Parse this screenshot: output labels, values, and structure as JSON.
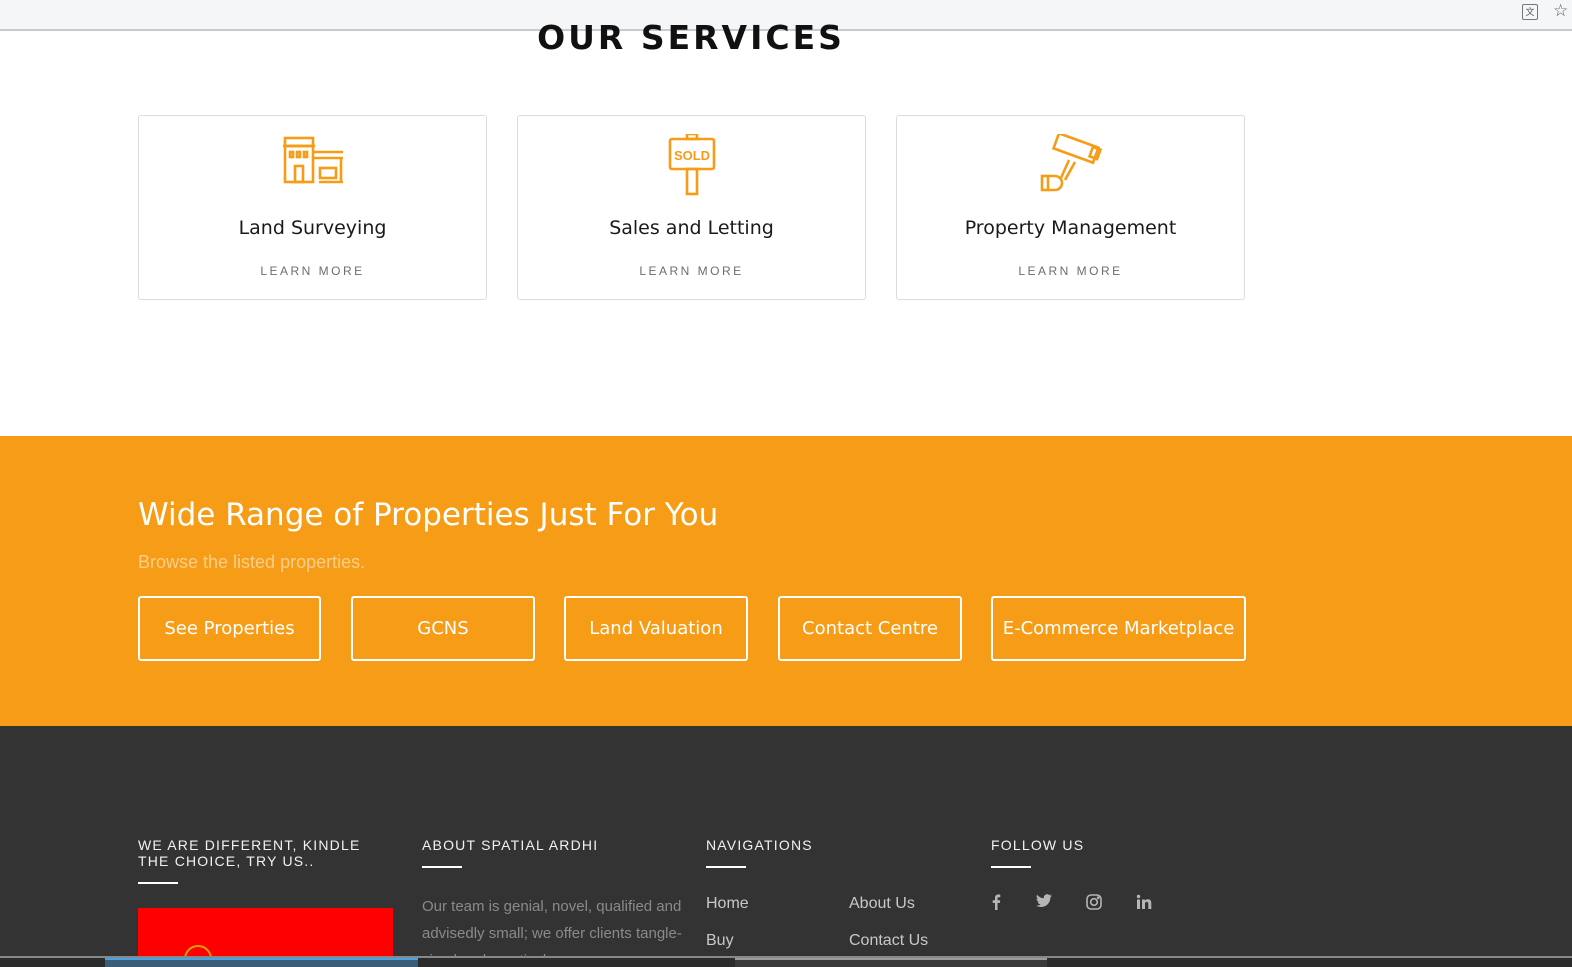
{
  "browser": {
    "translate_icon": "translate-icon",
    "bookmark_icon": "star-icon"
  },
  "services": {
    "title": "OUR SERVICES",
    "accent_color": "#f79c17",
    "cards": [
      {
        "title": "Land Surveying",
        "link": "LEARN MORE",
        "icon": "building-garage-icon"
      },
      {
        "title": "Sales and Letting",
        "link": "LEARN MORE",
        "icon": "sold-sign-icon",
        "icon_text": "SOLD"
      },
      {
        "title": "Property Management",
        "link": "LEARN MORE",
        "icon": "security-camera-icon"
      }
    ]
  },
  "banner": {
    "heading": "Wide Range of Properties Just For You",
    "subheading": "Browse the listed properties.",
    "background_color": "#f79c17",
    "buttons": [
      {
        "label": "See Properties"
      },
      {
        "label": "GCNS"
      },
      {
        "label": "Land Valuation"
      },
      {
        "label": "Contact Centre"
      },
      {
        "label": "E-Commerce Marketplace"
      }
    ]
  },
  "footer": {
    "background_color": "#333333",
    "col1_title_line1": "WE ARE DIFFERENT, KINDLE",
    "col1_title_line2": "THE CHOICE, TRY US..",
    "about_title": "ABOUT SPATIAL ARDHI",
    "about_text": "Our team is genial, novel, qualified and advisedly small; we offer clients tangle-sized and practical",
    "nav_title": "NAVIGATIONS",
    "nav_links": [
      "Home",
      "About Us",
      "Buy",
      "Contact Us"
    ],
    "follow_title": "FOLLOW US",
    "social": [
      {
        "icon": "facebook-icon",
        "glyph": "f"
      },
      {
        "icon": "twitter-icon",
        "glyph": "t"
      },
      {
        "icon": "instagram-icon",
        "glyph": "ig"
      },
      {
        "icon": "linkedin-icon",
        "glyph": "in"
      }
    ]
  }
}
